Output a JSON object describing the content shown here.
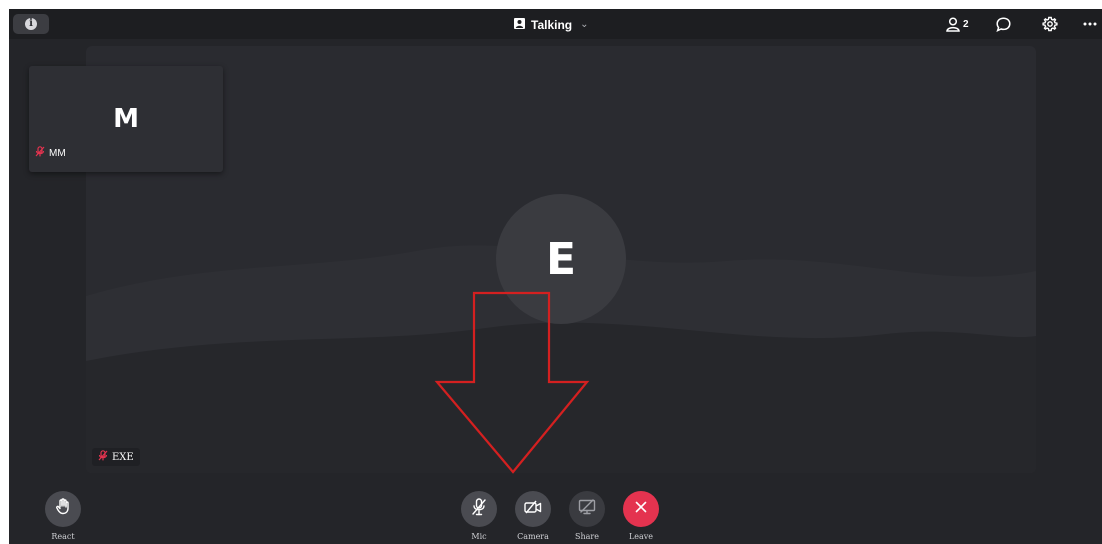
{
  "header": {
    "meeting_title": "Talking",
    "participant_count": "2",
    "icons": [
      "info-icon",
      "person-icon",
      "chevron-down-icon",
      "participants-icon",
      "chat-icon",
      "gear-icon",
      "more-icon"
    ]
  },
  "main_video": {
    "avatar_letter": "E",
    "name": "EXE",
    "muted": true
  },
  "thumbnail": {
    "avatar_letter": "M",
    "name": "MM",
    "muted": true
  },
  "controls": {
    "react_label": "React",
    "mic_label": "Mic",
    "camera_label": "Camera",
    "share_label": "Share",
    "leave_label": "Leave"
  },
  "colors": {
    "background": "#242529",
    "topbar": "#1d1e21",
    "leave": "#e4334f",
    "mute": "#e4334f",
    "annotation": "#d42020"
  }
}
